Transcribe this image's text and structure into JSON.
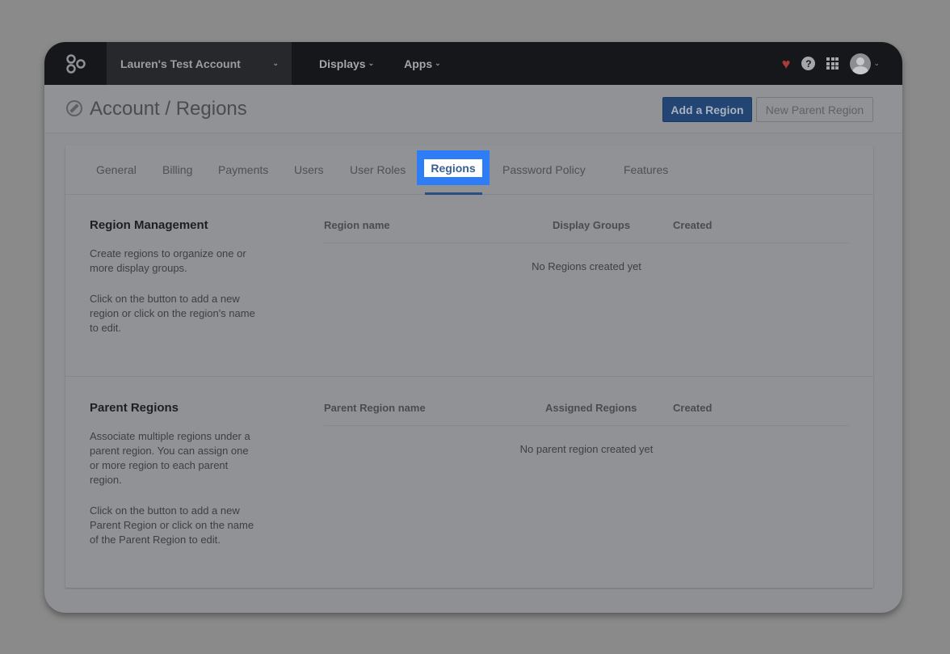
{
  "topbar": {
    "account_name": "Lauren's Test Account",
    "nav": [
      {
        "label": "Displays"
      },
      {
        "label": "Apps"
      }
    ],
    "help_glyph": "?"
  },
  "header": {
    "title": "Account / Regions",
    "add_region_label": "Add a Region",
    "new_parent_label": "New Parent Region"
  },
  "tabs": [
    {
      "label": "General"
    },
    {
      "label": "Billing"
    },
    {
      "label": "Payments"
    },
    {
      "label": "Users"
    },
    {
      "label": "User Roles"
    },
    {
      "label": "Regions",
      "active": true
    },
    {
      "label": "Password Policy"
    },
    {
      "label": "Features"
    }
  ],
  "region_management": {
    "title": "Region Management",
    "desc1": "Create regions to organize one or more display groups.",
    "desc2": "Click on the button to add a new region or click on the region's name to edit.",
    "columns": [
      "Region name",
      "Display Groups",
      "Created"
    ],
    "empty": "No Regions created yet"
  },
  "parent_regions": {
    "title": "Parent Regions",
    "desc1": "Associate multiple regions under a parent region. You can assign one or more region to each parent region.",
    "desc2": "Click on the button to add a new Parent Region or click on the name of the Parent Region to edit.",
    "columns": [
      "Parent Region name",
      "Assigned Regions",
      "Created"
    ],
    "empty": "No parent region created yet"
  },
  "colors": {
    "highlight": "#2e7cf6",
    "topbar": "#16171a",
    "primary_button": "#234573"
  },
  "icons": [
    "logo-icon",
    "chevron-down-icon",
    "heart-icon",
    "help-icon",
    "apps-grid-icon",
    "avatar",
    "compass-icon"
  ]
}
